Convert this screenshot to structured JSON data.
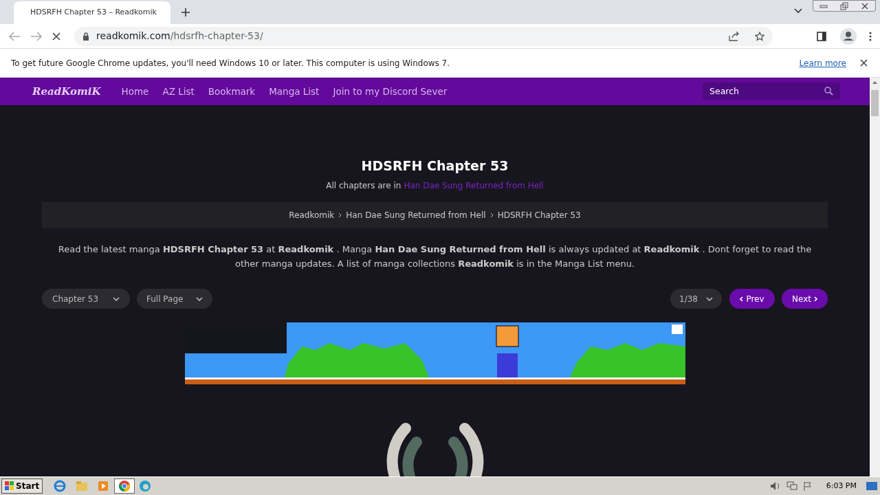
{
  "browser": {
    "tab_title": "HDSRFH Chapter 53 – Readkomik",
    "url_host": "readkomik.com",
    "url_path": "/hdsrfh-chapter-53/",
    "infobar": {
      "message": "To get future Google Chrome updates, you'll need Windows 10 or later. This computer is using Windows 7.",
      "link": "Learn more"
    }
  },
  "site": {
    "logo": "ReadKomiK",
    "nav": [
      "Home",
      "AZ List",
      "Bookmark",
      "Manga List",
      "Join to my Discord Sever"
    ],
    "search": {
      "placeholder": "Search"
    }
  },
  "page": {
    "title": "HDSRFH Chapter 53",
    "subtitle": {
      "text": "All chapters are in",
      "link": "Han Dae Sung Returned from Hell"
    },
    "breadcrumbs": [
      "Readkomik",
      "Han Dae Sung Returned from Hell",
      "HDSRFH Chapter 53"
    ],
    "description": "Read the latest manga **HDSRFH Chapter 53** at **Readkomik** . Manga **Han Dae Sung Returned from Hell** is always updated at **Readkomik** . Dont forget to read the other manga updates. A list of manga collections **Readkomik** is in the Manga List menu.",
    "chapter_select": "Chapter 53",
    "mode_select": "Full Page",
    "page_select": "1/38",
    "prev": "Prev",
    "next": "Next"
  },
  "taskbar": {
    "start": "Start",
    "time": "6:03 PM"
  }
}
